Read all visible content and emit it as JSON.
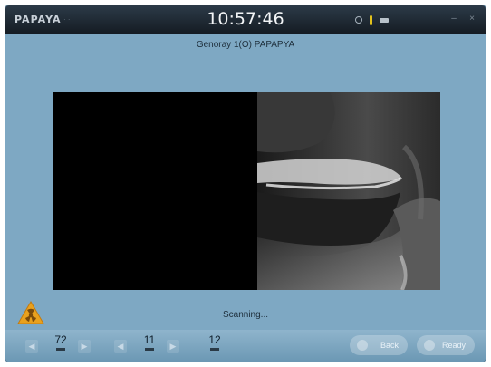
{
  "titlebar": {
    "brand": "PAPAYA",
    "clock": "10:57:46",
    "icons": [
      "status-circle-icon",
      "temperature-icon",
      "battery-icon"
    ],
    "controls": [
      "minimize-icon",
      "close-icon"
    ]
  },
  "patient": {
    "label": "Genoray   1(O)  PAPAPYA"
  },
  "status": {
    "text": "Scanning...",
    "warning_icon": "radiation-warning-icon"
  },
  "params": [
    {
      "value": "72"
    },
    {
      "value": "11"
    },
    {
      "value": "12"
    }
  ],
  "buttons": {
    "back": "Back",
    "ready": "Ready"
  },
  "colors": {
    "window_bg": "#7ea8c3",
    "titlebar_bg": "#1a232c",
    "scan_bg": "#000000",
    "hazard_orange": "#e9a11e"
  }
}
